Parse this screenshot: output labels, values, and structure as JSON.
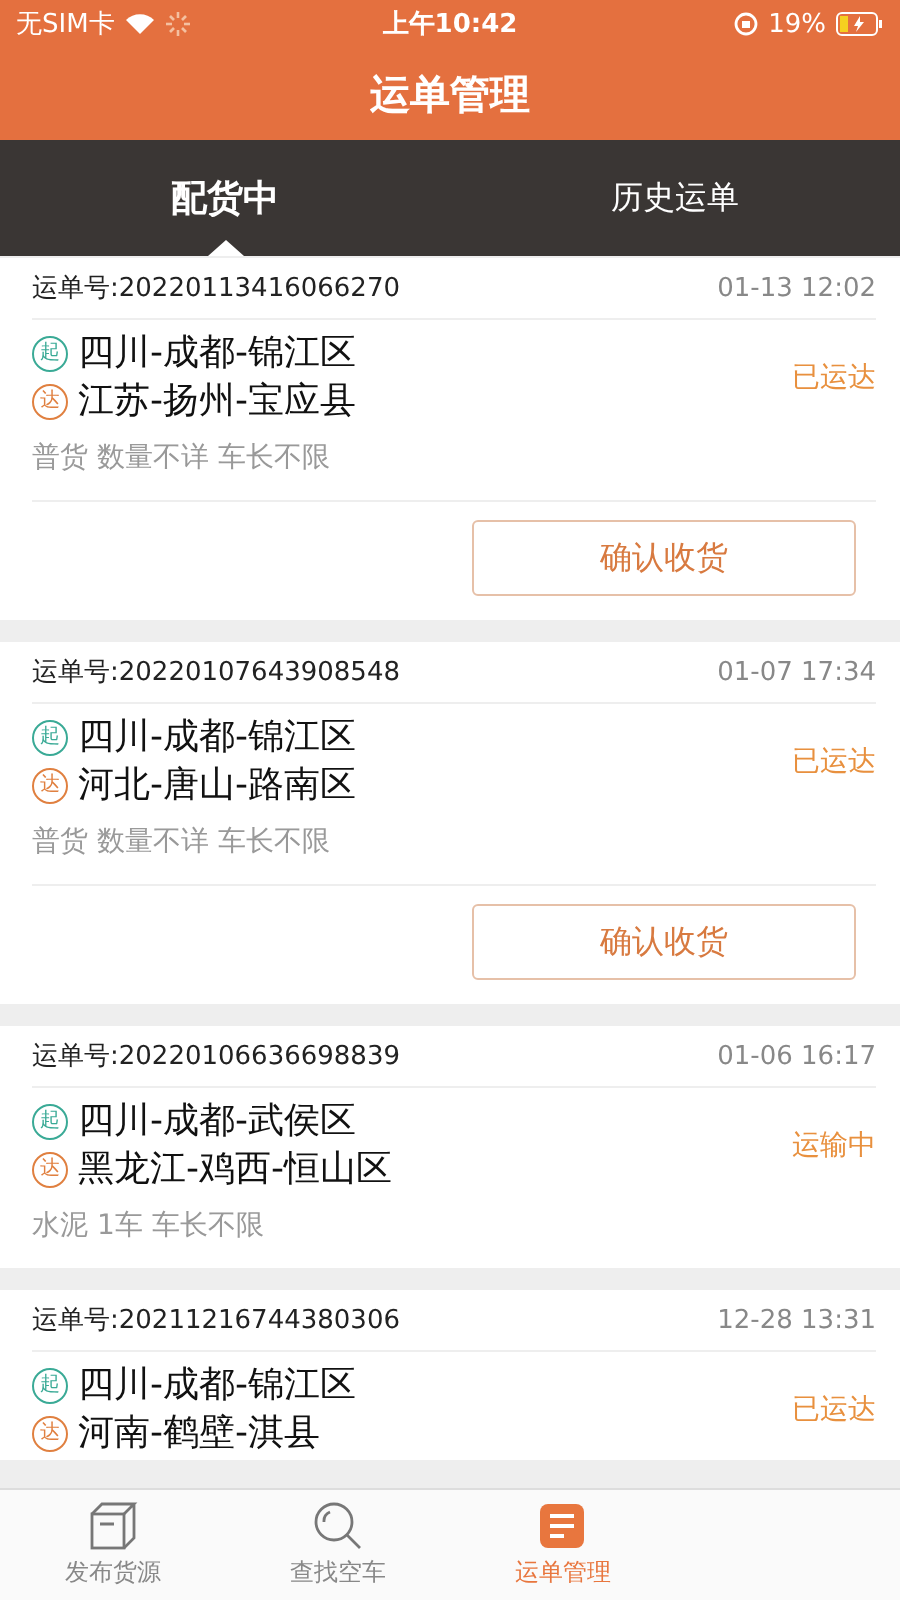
{
  "status_bar": {
    "carrier": "无SIM卡",
    "time": "上午10:42",
    "battery": "19%"
  },
  "title": "运单管理",
  "tabs": [
    {
      "label": "配货中",
      "selected": true
    },
    {
      "label": "历史运单",
      "selected": false
    }
  ],
  "orders": [
    {
      "number_label": "运单号:",
      "number": "20220113416066270",
      "time": "01-13 12:02",
      "from_mark": "起",
      "from": "四川-成都-锦江区",
      "to_mark": "达",
      "to": "江苏-扬州-宝应县",
      "status": "已运达",
      "desc": "普货 数量不详 车长不限",
      "action": "确认收货"
    },
    {
      "number_label": "运单号:",
      "number": "20220107643908548",
      "time": "01-07 17:34",
      "from_mark": "起",
      "from": "四川-成都-锦江区",
      "to_mark": "达",
      "to": "河北-唐山-路南区",
      "status": "已运达",
      "desc": "普货 数量不详 车长不限",
      "action": "确认收货"
    },
    {
      "number_label": "运单号:",
      "number": "20220106636698839",
      "time": "01-06 16:17",
      "from_mark": "起",
      "from": "四川-成都-武侯区",
      "to_mark": "达",
      "to": "黑龙江-鸡西-恒山区",
      "status": "运输中",
      "desc": "水泥 1车 车长不限"
    },
    {
      "number_label": "运单号:",
      "number": "20211216744380306",
      "time": "12-28 13:31",
      "from_mark": "起",
      "from": "四川-成都-锦江区",
      "to_mark": "达",
      "to": "河南-鹤壁-淇县",
      "status": "已运达"
    }
  ],
  "bottom_nav": [
    {
      "label": "发布货源",
      "kind": "box",
      "selected": false
    },
    {
      "label": "查找空车",
      "kind": "search",
      "selected": false
    },
    {
      "label": "运单管理",
      "kind": "list",
      "selected": true
    }
  ]
}
